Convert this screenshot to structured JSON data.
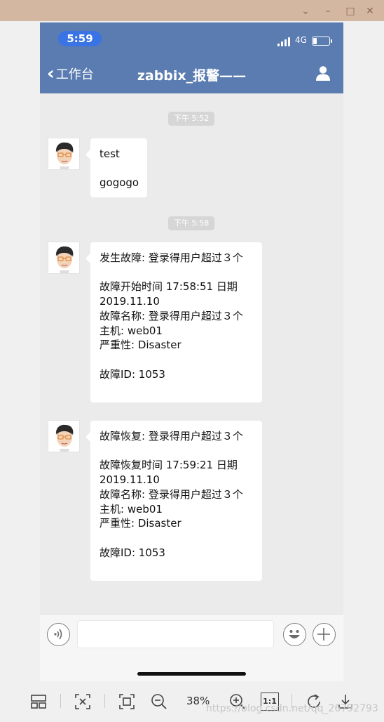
{
  "viewer": {
    "window_controls": {
      "chevron": "⌄",
      "minimize": "–",
      "maximize": "□",
      "close": "✕"
    },
    "toolbar": {
      "zoom_level": "38%",
      "one_to_one_label": "1:1",
      "icons": [
        "layout-icon",
        "fit-to-screen-icon",
        "full-size-icon",
        "zoom-out-icon",
        "zoom-in-icon",
        "actual-size-icon",
        "rotate-icon",
        "download-icon"
      ]
    },
    "watermark": "https://blog.csdn.net/qq_26792793"
  },
  "phone": {
    "status_bar": {
      "time": "5:59",
      "network": "4G",
      "battery_level": 0.2
    },
    "nav": {
      "back_label": "工作台",
      "title": "zabbix_报警——",
      "accent_color": "#5a7cb0"
    },
    "chat": {
      "timestamps": [
        "下午 5:52",
        "下午 5:58"
      ],
      "messages": [
        {
          "lines": [
            "test",
            "",
            "gogogo"
          ]
        },
        {
          "lines": [
            "发生故障: 登录得用户超过３个",
            "",
            "故障开始时间 17:58:51 日期",
            "2019.11.10",
            "故障名称: 登录得用户超过３个",
            "主机: web01",
            "严重性: Disaster",
            "",
            "故障ID: 1053",
            ""
          ]
        },
        {
          "lines": [
            "故障恢复: 登录得用户超过３个",
            "",
            "故障恢复时间 17:59:21 日期",
            "2019.11.10",
            "故障名称: 登录得用户超过３个",
            "主机: web01",
            "严重性: Disaster",
            "",
            "故障ID: 1053",
            ""
          ]
        }
      ]
    },
    "input_bar": {
      "input_value": ""
    }
  }
}
